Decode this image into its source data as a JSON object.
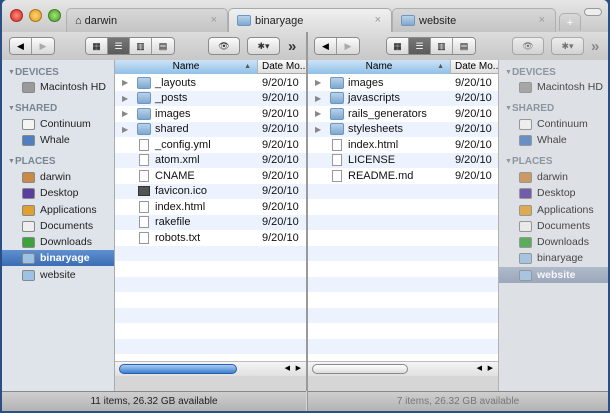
{
  "tabs": [
    {
      "label": "darwin",
      "icon": "home-icon",
      "active": false
    },
    {
      "label": "binaryage",
      "icon": "folder-icon",
      "active": true
    },
    {
      "label": "website",
      "icon": "folder-icon",
      "active": false
    }
  ],
  "toolbar": {
    "back": "◀",
    "forward": "▶",
    "quicklook": "👁",
    "action": "✱▾",
    "more": "»"
  },
  "view_modes": [
    "icon-view",
    "list-view",
    "column-view",
    "coverflow-view"
  ],
  "sidebar": {
    "sections": [
      {
        "title": "DEVICES",
        "items": [
          {
            "label": "Macintosh HD",
            "icon": "harddisk-icon"
          }
        ]
      },
      {
        "title": "SHARED",
        "items": [
          {
            "label": "Continuum",
            "icon": "server-icon"
          },
          {
            "label": "Whale",
            "icon": "display-icon"
          }
        ]
      },
      {
        "title": "PLACES",
        "items": [
          {
            "label": "darwin",
            "icon": "home-icon"
          },
          {
            "label": "Desktop",
            "icon": "desktop-icon"
          },
          {
            "label": "Applications",
            "icon": "applications-icon"
          },
          {
            "label": "Documents",
            "icon": "documents-icon"
          },
          {
            "label": "Downloads",
            "icon": "downloads-icon"
          },
          {
            "label": "binaryage",
            "icon": "folder-icon"
          },
          {
            "label": "website",
            "icon": "folder-icon"
          }
        ]
      }
    ]
  },
  "left_pane": {
    "columns": {
      "name": "Name",
      "date": "Date Mo.."
    },
    "files": [
      {
        "name": "_layouts",
        "date": "9/20/10",
        "type": "folder"
      },
      {
        "name": "_posts",
        "date": "9/20/10",
        "type": "folder"
      },
      {
        "name": "images",
        "date": "9/20/10",
        "type": "folder"
      },
      {
        "name": "shared",
        "date": "9/20/10",
        "type": "folder"
      },
      {
        "name": "_config.yml",
        "date": "9/20/10",
        "type": "file"
      },
      {
        "name": "atom.xml",
        "date": "9/20/10",
        "type": "file"
      },
      {
        "name": "CNAME",
        "date": "9/20/10",
        "type": "file"
      },
      {
        "name": "favicon.ico",
        "date": "9/20/10",
        "type": "image"
      },
      {
        "name": "index.html",
        "date": "9/20/10",
        "type": "file"
      },
      {
        "name": "rakefile",
        "date": "9/20/10",
        "type": "file"
      },
      {
        "name": "robots.txt",
        "date": "9/20/10",
        "type": "file"
      }
    ],
    "status": "11 items, 26.32 GB available",
    "selected_sidebar": "binaryage"
  },
  "right_pane": {
    "columns": {
      "name": "Name",
      "date": "Date Mo.."
    },
    "files": [
      {
        "name": "images",
        "date": "9/20/10",
        "type": "folder"
      },
      {
        "name": "javascripts",
        "date": "9/20/10",
        "type": "folder"
      },
      {
        "name": "rails_generators",
        "date": "9/20/10",
        "type": "folder"
      },
      {
        "name": "stylesheets",
        "date": "9/20/10",
        "type": "folder"
      },
      {
        "name": "index.html",
        "date": "9/20/10",
        "type": "file"
      },
      {
        "name": "LICENSE",
        "date": "9/20/10",
        "type": "file"
      },
      {
        "name": "README.md",
        "date": "9/20/10",
        "type": "file"
      }
    ],
    "status": "7 items, 26.32 GB available",
    "selected_sidebar": "website"
  },
  "colors": {
    "selection": "#3a6db5",
    "sidebar_bg": "#dfe4ea",
    "alt_row": "#edf3fe"
  }
}
